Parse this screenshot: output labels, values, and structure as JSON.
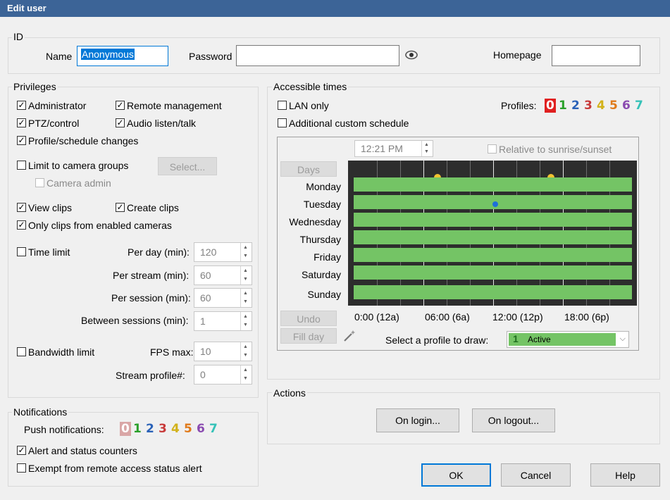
{
  "window": {
    "title": "Edit user"
  },
  "id_group": {
    "legend": "ID",
    "name_label": "Name",
    "name_value": "Anonymous",
    "password_label": "Password",
    "password_value": "",
    "homepage_label": "Homepage",
    "homepage_value": ""
  },
  "privileges": {
    "legend": "Privileges",
    "administrator": {
      "label": "Administrator",
      "checked": true
    },
    "remote_management": {
      "label": "Remote management",
      "checked": true
    },
    "ptz_control": {
      "label": "PTZ/control",
      "checked": true
    },
    "audio": {
      "label": "Audio listen/talk",
      "checked": true
    },
    "profile_changes": {
      "label": "Profile/schedule changes",
      "checked": true
    },
    "limit_groups": {
      "label": "Limit to camera groups",
      "checked": false
    },
    "select_button": "Select...",
    "camera_admin": {
      "label": "Camera admin",
      "checked": false
    },
    "view_clips": {
      "label": "View clips",
      "checked": true
    },
    "create_clips": {
      "label": "Create clips",
      "checked": true
    },
    "only_clips": {
      "label": "Only clips from enabled cameras",
      "checked": true
    },
    "time_limit": {
      "label": "Time limit",
      "checked": false
    },
    "per_day_label": "Per day (min):",
    "per_day_value": "120",
    "per_stream_label": "Per stream (min):",
    "per_stream_value": "60",
    "per_session_label": "Per session (min):",
    "per_session_value": "60",
    "between_label": "Between sessions (min):",
    "between_value": "1",
    "bandwidth": {
      "label": "Bandwidth limit",
      "checked": false
    },
    "fps_label": "FPS max:",
    "fps_value": "10",
    "stream_profile_label": "Stream profile#:",
    "stream_profile_value": "0"
  },
  "notifications": {
    "legend": "Notifications",
    "push_label": "Push notifications:",
    "push_profiles": [
      "0",
      "1",
      "2",
      "3",
      "4",
      "5",
      "6",
      "7"
    ],
    "alert_counters": {
      "label": "Alert and status counters",
      "checked": true
    },
    "exempt": {
      "label": "Exempt from remote access status alert",
      "checked": false
    }
  },
  "accessible": {
    "legend": "Accessible times",
    "lan_only": {
      "label": "LAN only",
      "checked": false
    },
    "custom_schedule": {
      "label": "Additional custom schedule",
      "checked": false
    },
    "profiles_label": "Profiles:",
    "profiles": [
      "0",
      "1",
      "2",
      "3",
      "4",
      "5",
      "6",
      "7"
    ],
    "profile_colors": [
      "#e02020",
      "#2aa02a",
      "#2a62b8",
      "#c83a3a",
      "#d2b21a",
      "#e07a1a",
      "#8a4ab0",
      "#36c2b8"
    ],
    "time_value": "12:21 PM",
    "relative_label": "Relative to sunrise/sunset",
    "days_button": "Days",
    "days": [
      "Monday",
      "Tuesday",
      "Wednesday",
      "Thursday",
      "Friday",
      "Saturday",
      "Sunday"
    ],
    "time_labels": [
      "0:00 (12a)",
      "06:00 (6a)",
      "12:00 (12p)",
      "18:00 (6p)"
    ],
    "undo_button": "Undo",
    "fill_day_button": "Fill day",
    "select_profile_label": "Select a profile to draw:",
    "selected_profile_num": "1",
    "selected_profile_name": "Active",
    "active_color": "#74c465"
  },
  "actions": {
    "legend": "Actions",
    "on_login": "On login...",
    "on_logout": "On logout..."
  },
  "footer": {
    "ok": "OK",
    "cancel": "Cancel",
    "help": "Help"
  }
}
